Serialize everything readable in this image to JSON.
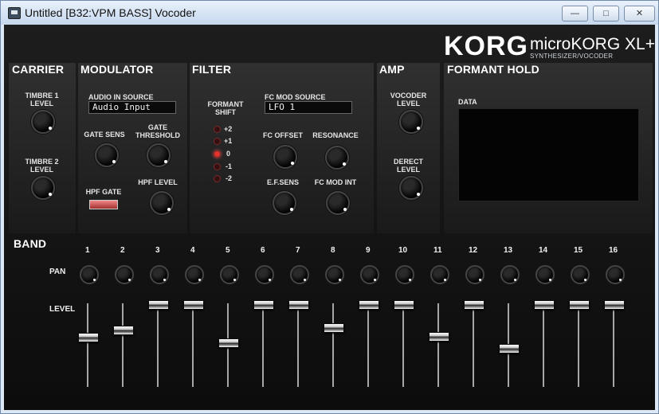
{
  "window": {
    "title": "Untitled [B32:VPM BASS] Vocoder",
    "buttons": [
      {
        "name": "minimize-button",
        "glyph": "—"
      },
      {
        "name": "maximize-button",
        "glyph": "□"
      },
      {
        "name": "close-button",
        "glyph": "✕"
      }
    ]
  },
  "branding": {
    "korg": "KORG",
    "micro": "microKORG XL+",
    "sub": "SYNTHESIZER/VOCODER"
  },
  "sections": {
    "carrier": {
      "title": "CARRIER",
      "knobs": [
        {
          "label": "TIMBRE 1\nLEVEL"
        },
        {
          "label": "TIMBRE 2\nLEVEL"
        }
      ]
    },
    "modulator": {
      "title": "MODULATOR",
      "audio_in_source_label": "AUDIO IN SOURCE",
      "audio_in_source_value": "Audio Input",
      "knobs": [
        {
          "label": "GATE SENS"
        },
        {
          "label": "GATE\nTHRESHOLD"
        },
        {
          "label": "HPF LEVEL"
        }
      ],
      "hpf_gate_label": "HPF GATE"
    },
    "filter": {
      "title": "FILTER",
      "formant_shift_label": "FORMANT\nSHIFT",
      "formant_shift_options": [
        "+2",
        "+1",
        "0",
        "-1",
        "-2"
      ],
      "formant_shift_selected": 2,
      "fc_mod_source_label": "FC MOD SOURCE",
      "fc_mod_source_value": "LFO 1",
      "knobs": [
        {
          "label": "FC OFFSET"
        },
        {
          "label": "RESONANCE"
        },
        {
          "label": "E.F.SENS"
        },
        {
          "label": "FC MOD INT"
        }
      ]
    },
    "amp": {
      "title": "AMP",
      "knobs": [
        {
          "label": "VOCODER\nLEVEL"
        },
        {
          "label": "DERECT\nLEVEL"
        }
      ]
    },
    "formant_hold": {
      "title": "FORMANT HOLD",
      "data_label": "DATA"
    }
  },
  "band": {
    "title": "BAND",
    "pan_label": "PAN",
    "level_label": "LEVEL",
    "numbers": [
      "1",
      "2",
      "3",
      "4",
      "5",
      "6",
      "7",
      "8",
      "9",
      "10",
      "11",
      "12",
      "13",
      "14",
      "15",
      "16"
    ],
    "levels": [
      0.55,
      0.64,
      1.0,
      1.0,
      0.45,
      1.0,
      1.0,
      0.67,
      1.0,
      1.0,
      0.56,
      1.0,
      0.42,
      1.0,
      1.0,
      1.0
    ]
  }
}
